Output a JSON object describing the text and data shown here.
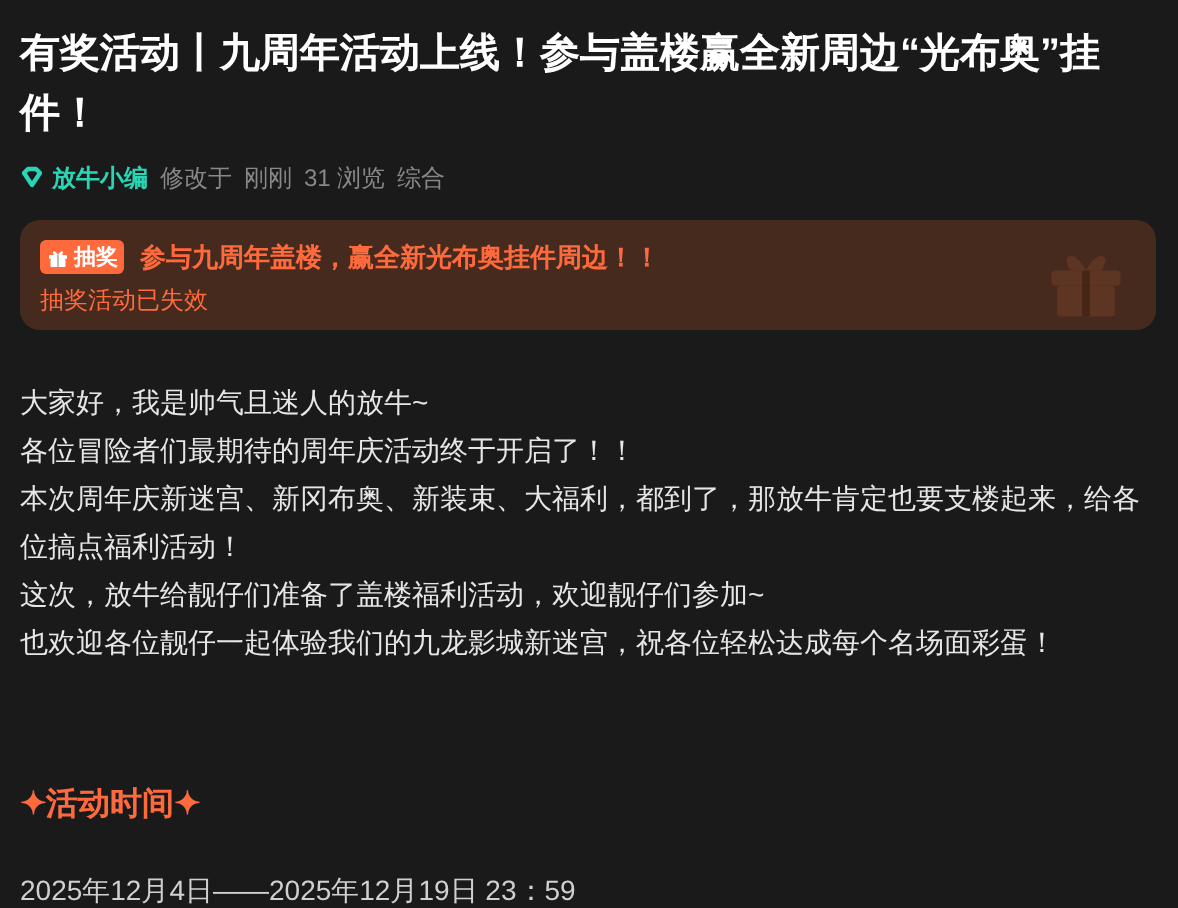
{
  "title": "有奖活动丨九周年活动上线！参与盖楼赢全新周边“光布奥”挂件！",
  "meta": {
    "author": "放牛小编",
    "modified_label": "修改于",
    "modified_time": "刚刚",
    "views": "31 浏览",
    "category": "综合"
  },
  "lottery": {
    "badge": "抽奖",
    "headline": "参与九周年盖楼，赢全新光布奥挂件周边！！",
    "status": "抽奖活动已失效"
  },
  "paragraphs": [
    "大家好，我是帅气且迷人的放牛~",
    "各位冒险者们最期待的周年庆活动终于开启了！！",
    "本次周年庆新迷宫、新冈布奥、新装束、大福利，都到了，那放牛肯定也要支楼起来，给各位搞点福利活动！",
    "这次，放牛给靓仔们准备了盖楼福利活动，欢迎靓仔们参加~",
    "也欢迎各位靓仔一起体验我们的九龙影城新迷宫，祝各位轻松达成每个名场面彩蛋！"
  ],
  "section_heading": "✦活动时间✦",
  "event_time": "2025年12月4日——2025年12月19日 23：59"
}
